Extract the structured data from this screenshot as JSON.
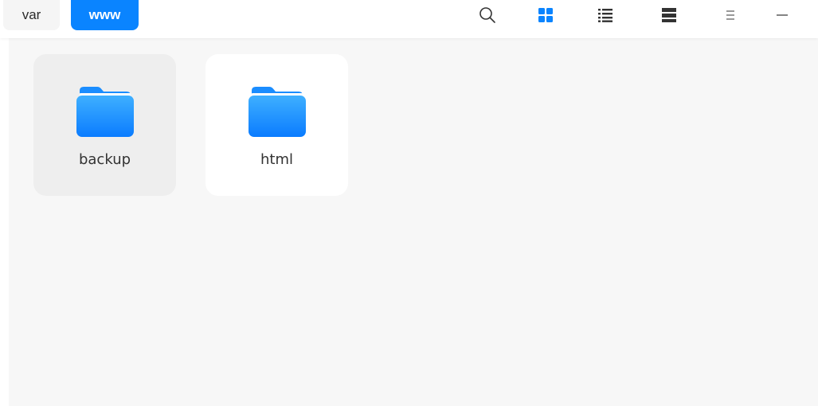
{
  "breadcrumb": {
    "items": [
      {
        "label": "var",
        "active": false
      },
      {
        "label": "www",
        "active": true
      }
    ]
  },
  "toolbar": {
    "buttons": [
      {
        "name": "search-icon",
        "active": false
      },
      {
        "name": "grid-view-icon",
        "active": true
      },
      {
        "name": "list-view-icon",
        "active": false
      },
      {
        "name": "tree-view-icon",
        "active": false
      },
      {
        "name": "menu-icon",
        "active": false
      },
      {
        "name": "minimize-icon",
        "active": false
      }
    ]
  },
  "files": [
    {
      "name": "backup",
      "type": "folder",
      "selected": true
    },
    {
      "name": "html",
      "type": "folder",
      "selected": false
    }
  ],
  "colors": {
    "accent": "#0a84ff",
    "folder_top": "#3fb0ff",
    "folder_bottom": "#0a7cff",
    "content_bg": "#f7f7f7"
  }
}
